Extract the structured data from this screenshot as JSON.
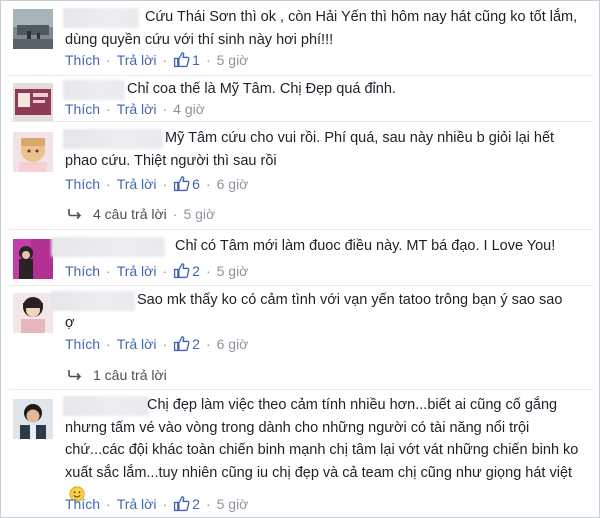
{
  "comments": [
    {
      "text": "Cứu Thái Sơn thì ok , còn Hải Yến thì hôm nay hát cũng ko tốt lắm, dùng quyền cứu với thí sinh này hơi phí!!!",
      "like_label": "Thích",
      "reply_label": "Trả lời",
      "likes": "1",
      "time": "5 giờ"
    },
    {
      "text": "Chỉ coa thế là Mỹ Tâm. Chị Đẹp quá đỉnh.",
      "like_label": "Thích",
      "reply_label": "Trả lời",
      "time": "4 giờ"
    },
    {
      "text": "Mỹ Tâm cứu cho vui rồi. Phí quá, sau này nhiều b giỏi lại hết phao cứu. Thiệt người thì sau rồi",
      "like_label": "Thích",
      "reply_label": "Trả lời",
      "likes": "6",
      "time": "6 giờ",
      "replies_label": "4 câu trả lời",
      "replies_time": "5 giờ"
    },
    {
      "text": "Chỉ có Tâm mới làm đuoc điều này. MT bá đạo. I Love You!",
      "like_label": "Thích",
      "reply_label": "Trả lời",
      "likes": "2",
      "time": "5 giờ"
    },
    {
      "text": "Sao mk thấy ko có cảm tình với vạn yến tatoo trông bạn ý sao sao ợ",
      "like_label": "Thích",
      "reply_label": "Trả lời",
      "likes": "2",
      "time": "6 giờ",
      "replies_label": "1 câu trả lời"
    },
    {
      "text": "Chị đẹp làm việc theo cảm tính nhiều hơn...biết ai cũng cố gắng nhưng tấm vé vào vòng trong dành cho những người có tài năng nổi trội chứ...các đội khác toàn chiến binh mạnh chị tâm lại vớt vát những chiến binh ko xuất sắc lắm...tuy nhiên cũng iu chị đẹp và cả team chị cũng như giọng hát việt",
      "like_label": "Thích",
      "reply_label": "Trả lời",
      "likes": "2",
      "time": "5 giờ"
    }
  ],
  "colors": {
    "link": "#4267b2",
    "meta": "#8d949e",
    "text": "#1d2129"
  }
}
